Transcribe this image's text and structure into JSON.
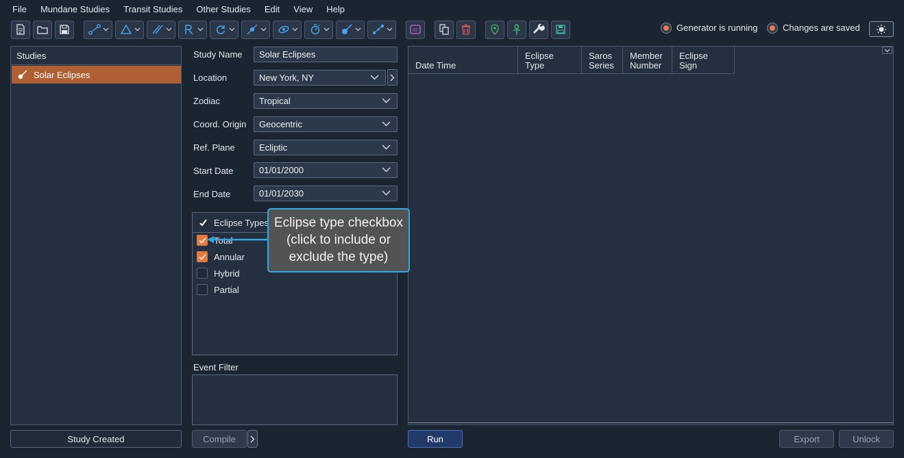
{
  "menu": [
    "File",
    "Mundane Studies",
    "Transit Studies",
    "Other Studies",
    "Edit",
    "View",
    "Help"
  ],
  "toolbar": {
    "icons": [
      "new-file-icon",
      "open-folder-icon",
      "save-icon",
      "aspect-line-icon",
      "triangle-icon",
      "parallel-icon",
      "retrograde-icon",
      "cycle-icon",
      "planet-node-icon",
      "orbit-icon",
      "timer-icon",
      "eclipse-icon",
      "midpoint-icon",
      "calendar-icon",
      "copy-icon",
      "delete-icon",
      "location-icon",
      "ankh-icon",
      "wrench-icon",
      "save-data-icon"
    ],
    "calendar_label": "07"
  },
  "status": {
    "generator": "Generator is running",
    "saved": "Changes are saved"
  },
  "studies": {
    "header": "Studies",
    "items": [
      {
        "label": "Solar Eclipses",
        "icon": "eclipse-icon"
      }
    ],
    "footer_button": "Study Created"
  },
  "form": {
    "study_name_label": "Study Name",
    "study_name": "Solar Eclipses",
    "location_label": "Location",
    "location": "New York, NY",
    "zodiac_label": "Zodiac",
    "zodiac": "Tropical",
    "coord_origin_label": "Coord. Origin",
    "coord_origin": "Geocentric",
    "ref_plane_label": "Ref. Plane",
    "ref_plane": "Ecliptic",
    "start_date_label": "Start Date",
    "start_date": "01/01/2000",
    "end_date_label": "End Date",
    "end_date": "01/01/2030"
  },
  "eclipse_types": {
    "header": "Eclipse Types",
    "items": [
      {
        "label": "Total",
        "checked": true
      },
      {
        "label": "Annular",
        "checked": true
      },
      {
        "label": "Hybrid",
        "checked": false
      },
      {
        "label": "Partial",
        "checked": false
      }
    ]
  },
  "event_filter": {
    "label": "Event Filter"
  },
  "buttons": {
    "compile": "Compile",
    "run": "Run",
    "export": "Export",
    "unlock": "Unlock"
  },
  "results": {
    "columns": [
      "Date Time",
      "Eclipse Type",
      "Saros Series",
      "Member Number",
      "Eclipse Sign"
    ]
  },
  "callout": {
    "text": "Eclipse type checkbox (click to include or exclude the type)"
  },
  "colors": {
    "accent": "#e47a3c",
    "selection": "#b05f35",
    "callout_border": "#32a8e2",
    "background": "#1b2431"
  }
}
